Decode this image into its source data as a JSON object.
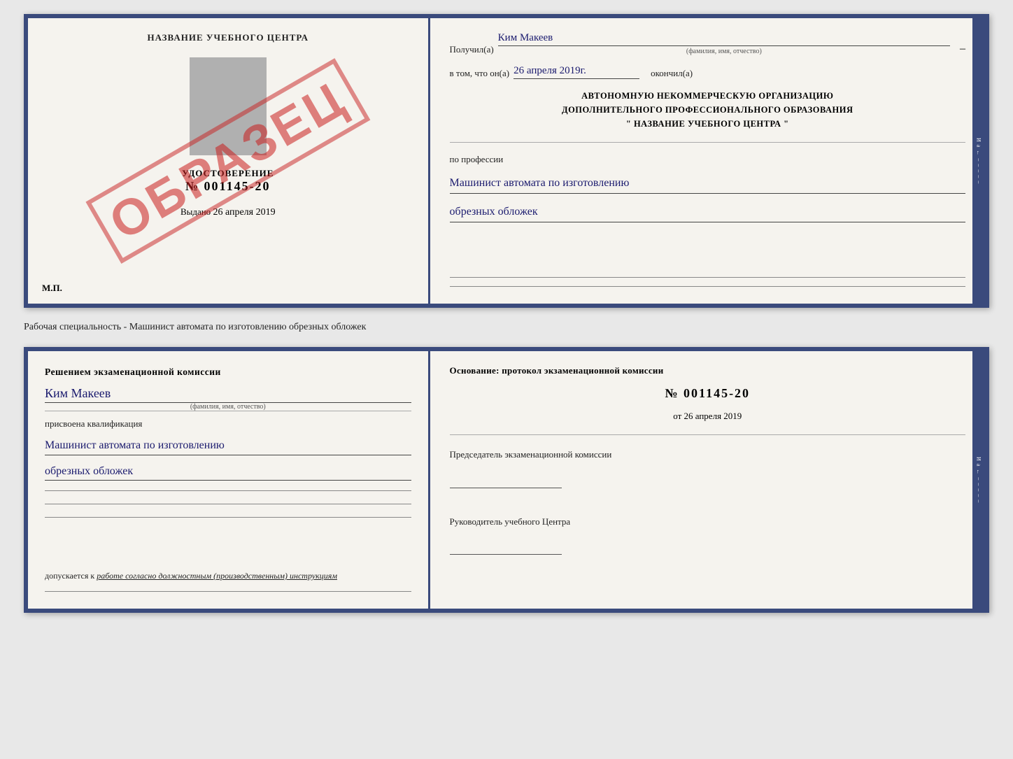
{
  "top_doc": {
    "left": {
      "title": "НАЗВАНИЕ УЧЕБНОГО ЦЕНТРА",
      "watermark": "ОБРАЗЕЦ",
      "cert_label": "УДОСТОВЕРЕНИЕ",
      "cert_number": "№ 001145-20",
      "issued_label": "Выдано",
      "issued_date": "26 апреля 2019",
      "mp_label": "М.П."
    },
    "right": {
      "received_label": "Получил(а)",
      "person_name": "Ким Макеев",
      "name_sublabel": "(фамилия, имя, отчество)",
      "in_that_label": "в том, что он(а)",
      "completion_date": "26 апреля 2019г.",
      "finished_label": "окончил(а)",
      "org_line1": "АВТОНОМНУЮ НЕКОММЕРЧЕСКУЮ ОРГАНИЗАЦИЮ",
      "org_line2": "ДОПОЛНИТЕЛЬНОГО ПРОФЕССИОНАЛЬНОГО ОБРАЗОВАНИЯ",
      "org_line3": "\"  НАЗВАНИЕ УЧЕБНОГО ЦЕНТРА  \"",
      "profession_label": "по профессии",
      "profession_line1": "Машинист автомата по изготовлению",
      "profession_line2": "обрезных обложек"
    }
  },
  "separator": {
    "text": "Рабочая специальность - Машинист автомата по изготовлению обрезных обложек"
  },
  "bottom_doc": {
    "left": {
      "komissia_text": "Решением экзаменационной комиссии",
      "person_name": "Ким Макеев",
      "name_sublabel": "(фамилия, имя, отчество)",
      "assigned_label": "присвоена квалификация",
      "qualification_line1": "Машинист автомата по изготовлению",
      "qualification_line2": "обрезных обложек",
      "допускается_prefix": "допускается к",
      "допускается_text": "работе согласно должностным (производственным) инструкциям"
    },
    "right": {
      "osnov_text": "Основание: протокол экзаменационной комиссии",
      "protocol_number": "№  001145-20",
      "protocol_date_prefix": "от",
      "protocol_date": "26 апреля 2019",
      "chairman_label": "Председатель экзаменационной комиссии",
      "director_label": "Руководитель учебного Центра"
    }
  },
  "spine": {
    "text_items": [
      "И",
      "а",
      "←",
      "–",
      "–",
      "–",
      "–",
      "–"
    ]
  }
}
